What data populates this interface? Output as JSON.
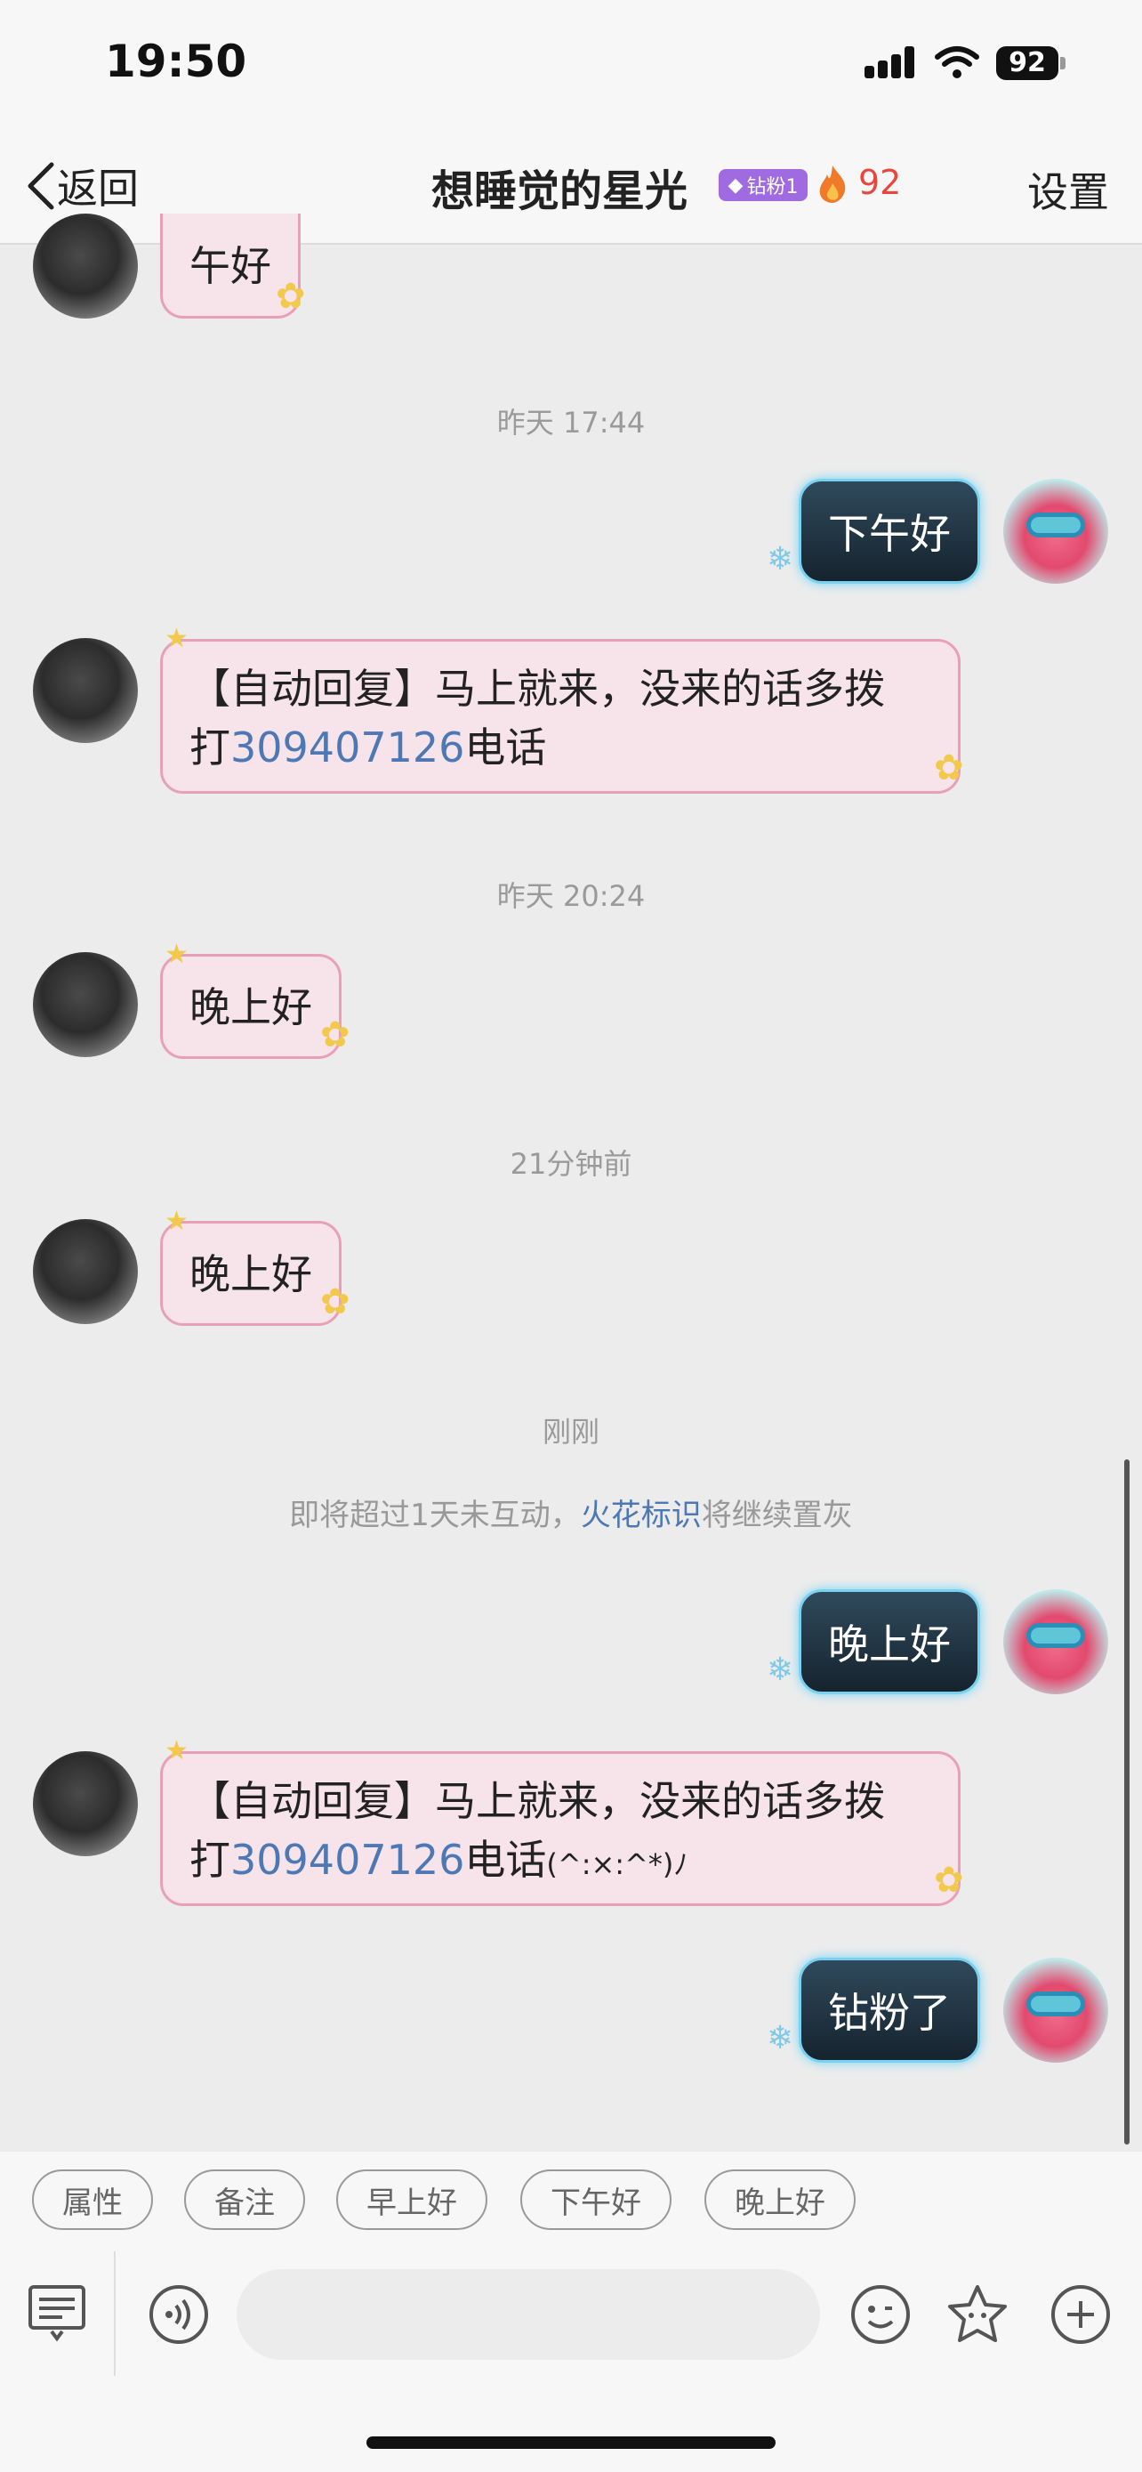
{
  "status_bar": {
    "time": "19:50",
    "battery": "92"
  },
  "header": {
    "back_label": "返回",
    "title": "想睡觉的星光",
    "badge": "钻粉1",
    "fire_count": "92",
    "settings_label": "设置"
  },
  "messages": {
    "m1": "午好",
    "ts1": "昨天 17:44",
    "m2": "下午好",
    "auto_prefix": "【自动回复】马上就来，没来的话多拨",
    "auto_line2_pre": "打",
    "phone": "309407126",
    "auto_line2_post": "电话",
    "ts2": "昨天 20:24",
    "m4": "晚上好",
    "ts3": "21分钟前",
    "m5": "晚上好",
    "ts4": "刚刚",
    "notice_pre": "即将超过1天未互动，",
    "notice_link": "火花标识",
    "notice_post": "将继续置灰",
    "m6": "晚上好",
    "auto_emoticon": "(^:×:^*)ﾉ",
    "m8": "钻粉了"
  },
  "quick_replies": [
    "属性",
    "备注",
    "早上好",
    "下午好",
    "晚上好"
  ],
  "input": {
    "placeholder": ""
  }
}
